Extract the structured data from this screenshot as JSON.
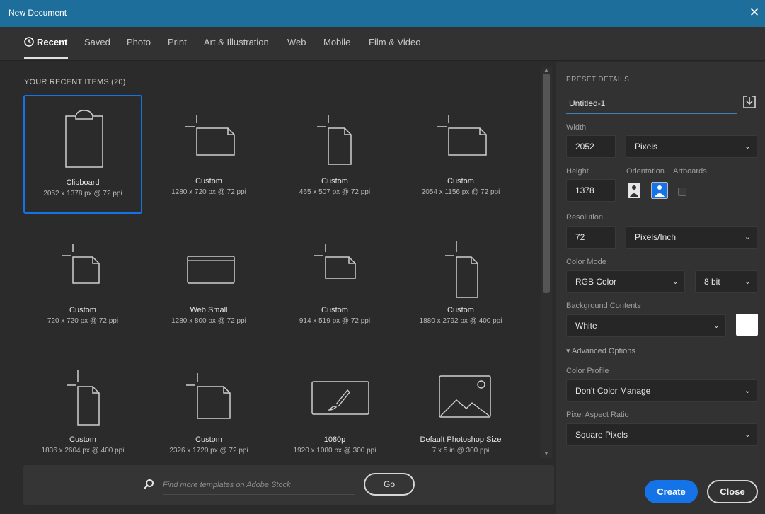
{
  "window": {
    "title": "New Document",
    "close_glyph": "✕"
  },
  "tabs": [
    {
      "label": "Recent",
      "active": true
    },
    {
      "label": "Saved"
    },
    {
      "label": "Photo"
    },
    {
      "label": "Print"
    },
    {
      "label": "Art & Illustration"
    },
    {
      "label": "Web"
    },
    {
      "label": "Mobile"
    },
    {
      "label": "Film & Video"
    }
  ],
  "recent": {
    "heading": "YOUR RECENT ITEMS  (20)",
    "items": [
      {
        "name": "Clipboard",
        "size": "2052 x 1378 px @ 72 ppi",
        "icon": "clipboard-icon",
        "selected": true
      },
      {
        "name": "Custom",
        "size": "1280 x 720 px @ 72 ppi",
        "icon": "landscape-doc-icon"
      },
      {
        "name": "Custom",
        "size": "465 x 507 px @ 72 ppi",
        "icon": "portrait-doc-icon"
      },
      {
        "name": "Custom",
        "size": "2054 x 1156 px @ 72 ppi",
        "icon": "landscape-doc-icon"
      },
      {
        "name": "Custom",
        "size": "720 x 720 px @ 72 ppi",
        "icon": "square-doc-icon"
      },
      {
        "name": "Web Small",
        "size": "1280 x 800 px @ 72 ppi",
        "icon": "browser-window-icon"
      },
      {
        "name": "Custom",
        "size": "914 x 519 px @ 72 ppi",
        "icon": "landscape-doc-icon"
      },
      {
        "name": "Custom",
        "size": "1880 x 2792 px @ 400 ppi",
        "icon": "portrait-doc-icon"
      },
      {
        "name": "Custom",
        "size": "1836 x 2604 px @ 400 ppi",
        "icon": "portrait-doc-icon"
      },
      {
        "name": "Custom",
        "size": "2326 x 1720 px @ 72 ppi",
        "icon": "landscape-doc-icon"
      },
      {
        "name": "1080p",
        "size": "1920 x 1080 px @ 300 ppi",
        "icon": "brush-screen-icon"
      },
      {
        "name": "Default Photoshop Size",
        "size": "7 x 5 in @ 300 ppi",
        "icon": "mountain-image-icon"
      }
    ]
  },
  "search": {
    "placeholder": "Find more templates on Adobe Stock",
    "go_label": "Go"
  },
  "preset": {
    "heading": "PRESET DETAILS",
    "name": "Untitled-1",
    "width_label": "Width",
    "width_value": "2052",
    "width_unit": "Pixels",
    "height_label": "Height",
    "height_value": "1378",
    "orientation_label": "Orientation",
    "artboards_label": "Artboards",
    "resolution_label": "Resolution",
    "resolution_value": "72",
    "resolution_unit": "Pixels/Inch",
    "color_mode_label": "Color Mode",
    "color_mode": "RGB Color",
    "bit_depth": "8 bit",
    "background_label": "Background Contents",
    "background": "White",
    "advanced_label": "Advanced Options",
    "color_profile_label": "Color Profile",
    "color_profile": "Don't Color Manage",
    "pixel_aspect_label": "Pixel Aspect Ratio",
    "pixel_aspect": "Square Pixels",
    "chevron": "⌄"
  },
  "actions": {
    "create": "Create",
    "close": "Close"
  },
  "colors": {
    "accent": "#1473e6",
    "titlebar": "#1d6e9b",
    "background_swatch": "#ffffff"
  }
}
